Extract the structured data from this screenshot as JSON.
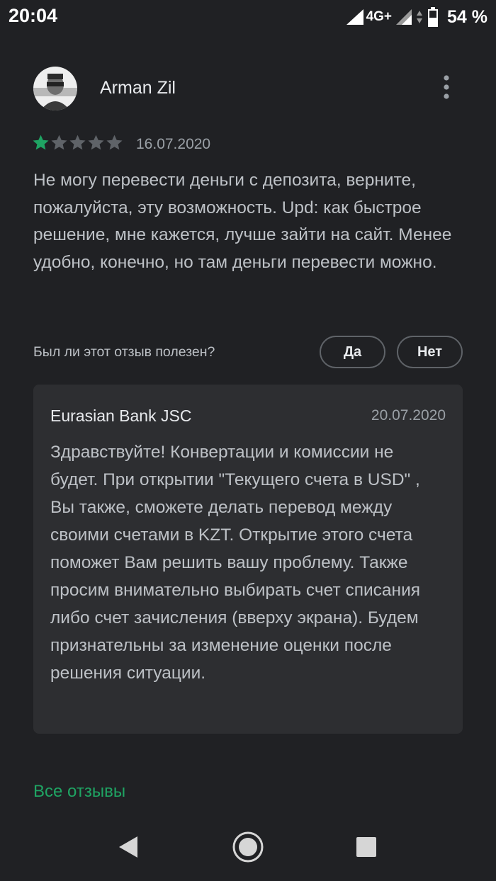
{
  "status_bar": {
    "time": "20:04",
    "network_label": "4G+",
    "battery_percent": "54 %"
  },
  "review": {
    "author": "Arman Zil",
    "rating": 1,
    "max_rating": 5,
    "date": "16.07.2020",
    "text": "Не могу перевести деньги с депозита, верните, пожалуйста, эту возможность. Upd: как быстрое решение, мне кажется, лучше зайти на сайт. Менее удобно, конечно, но там деньги перевести можно."
  },
  "helpful": {
    "question": "Был ли этот отзыв полезен?",
    "yes_label": "Да",
    "no_label": "Нет"
  },
  "reply": {
    "author": "Eurasian Bank JSC",
    "date": "20.07.2020",
    "text": "Здравствуйте! Конвертации и комиссии не будет. При открытии \"Текущего счета в USD\" , Вы также, сможете делать перевод между своими счетами в KZT. Открытие этого счета поможет Вам решить вашу проблему. Также просим внимательно выбирать счет списания либо счет зачисления (вверху экрана). Будем признательны за изменение оценки после решения ситуации."
  },
  "footer": {
    "all_reviews_label": "Все отзывы"
  },
  "colors": {
    "background": "#202124",
    "card": "#2d2e31",
    "accent_green": "#1fa463",
    "star_filled": "#1fa463",
    "star_empty": "#5f6368"
  },
  "icons": {
    "more": "more-vert-icon",
    "back": "back-triangle-icon",
    "home": "home-circle-icon",
    "recents": "recents-square-icon"
  }
}
